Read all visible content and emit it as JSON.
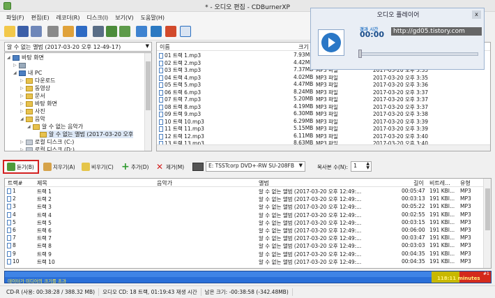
{
  "window": {
    "title": "* - 오디오 편집 - CDBurnerXP"
  },
  "menu": [
    "파일(F)",
    "편집(E)",
    "레코더(R)",
    "디스크(I)",
    "보기(V)",
    "도움말(H)"
  ],
  "toolbar_icons": [
    "new-icon",
    "save-icon",
    "save-as-icon",
    "print-icon",
    "add-icon",
    "remove-icon",
    "burn-icon",
    "copy-disc-icon",
    "erase-icon",
    "settings-icon",
    "network-icon",
    "help-icon",
    "info-icon"
  ],
  "album_select": {
    "value": "알 수 없는 앨범 (2017-03-20 오후 12-49-17)"
  },
  "tree": [
    {
      "label": "바탕 화면",
      "indent": 0
    },
    {
      "label": "",
      "indent": 1
    },
    {
      "label": "내 PC",
      "indent": 1
    },
    {
      "label": "다운로드",
      "indent": 2
    },
    {
      "label": "동영상",
      "indent": 2
    },
    {
      "label": "문서",
      "indent": 2
    },
    {
      "label": "바탕 화면",
      "indent": 2
    },
    {
      "label": "사진",
      "indent": 2
    },
    {
      "label": "음악",
      "indent": 2
    },
    {
      "label": "알 수 없는 음악가",
      "indent": 3
    },
    {
      "label": "알 수 없는 앨범 (2017-03-20 오후",
      "indent": 4
    },
    {
      "label": "로컬 디스크 (C:)",
      "indent": 2
    },
    {
      "label": "로컬 디스크 (D:)",
      "indent": 2
    }
  ],
  "file_list": {
    "headers": {
      "name": "이름",
      "size": "크기"
    },
    "rows": [
      {
        "name": "01 트랙 1.mp3",
        "size": "7.93MB",
        "type": "",
        "date": ""
      },
      {
        "name": "02 트랙 2.mp3",
        "size": "4.42MB",
        "type": "",
        "date": ""
      },
      {
        "name": "03 트랙 3.mp3",
        "size": "7.37MB",
        "type": "MP3 파일",
        "date": "2017-03-20 오후 3:35"
      },
      {
        "name": "04 트랙 4.mp3",
        "size": "4.02MB",
        "type": "MP3 파일",
        "date": "2017-03-20 오후 3:35"
      },
      {
        "name": "05 트랙 5.mp3",
        "size": "4.47MB",
        "type": "MP3 파일",
        "date": "2017-03-20 오후 3:36"
      },
      {
        "name": "06 트랙 6.mp3",
        "size": "8.24MB",
        "type": "MP3 파일",
        "date": "2017-03-20 오후 3:37"
      },
      {
        "name": "07 트랙 7.mp3",
        "size": "5.20MB",
        "type": "MP3 파일",
        "date": "2017-03-20 오후 3:37"
      },
      {
        "name": "08 트랙 8.mp3",
        "size": "4.19MB",
        "type": "MP3 파일",
        "date": "2017-03-20 오후 3:37"
      },
      {
        "name": "09 트랙 9.mp3",
        "size": "6.30MB",
        "type": "MP3 파일",
        "date": "2017-03-20 오후 3:38"
      },
      {
        "name": "10 트랙 10.mp3",
        "size": "6.29MB",
        "type": "MP3 파일",
        "date": "2017-03-20 오후 3:39"
      },
      {
        "name": "11 트랙 11.mp3",
        "size": "5.15MB",
        "type": "MP3 파일",
        "date": "2017-03-20 오후 3:39"
      },
      {
        "name": "12 트랙 12.mp3",
        "size": "6.11MB",
        "type": "MP3 파일",
        "date": "2017-03-20 오후 3:40"
      },
      {
        "name": "13 트랙 13.mp3",
        "size": "8.63MB",
        "type": "MP3 파일",
        "date": "2017-03-20 오후 3:40"
      }
    ]
  },
  "actions": {
    "play": "듣기(B)",
    "erase": "지우기(A)",
    "clear": "비우기(C)",
    "add": "추가(D)",
    "remove": "제거(M)",
    "drive": "E: TSSTcorp DVD+-RW SU-208FB",
    "copies_label": "복사본 수(N):",
    "copies_value": "1"
  },
  "grid": {
    "headers": {
      "track": "트랙#",
      "title": "제목",
      "artist": "음악가",
      "album": "앨범",
      "length": "길이",
      "bitrate": "비트레...",
      "type": "유형"
    },
    "rows": [
      {
        "track": "1",
        "title": "트랙 1",
        "artist": "",
        "album": "알 수 없는 앨범 (2017-03-20 오후 12:49:...",
        "length": "00:05:47",
        "bitrate": "191 KBI...",
        "type": "MP3"
      },
      {
        "track": "2",
        "title": "트랙 2",
        "artist": "",
        "album": "알 수 없는 앨범 (2017-03-20 오후 12:49:...",
        "length": "00:03:13",
        "bitrate": "191 KBI...",
        "type": "MP3"
      },
      {
        "track": "3",
        "title": "트랙 3",
        "artist": "",
        "album": "알 수 없는 앨범 (2017-03-20 오후 12:49:...",
        "length": "00:05:22",
        "bitrate": "191 KBI...",
        "type": "MP3"
      },
      {
        "track": "4",
        "title": "트랙 4",
        "artist": "",
        "album": "알 수 없는 앨범 (2017-03-20 오후 12:49:...",
        "length": "00:02:55",
        "bitrate": "191 KBI...",
        "type": "MP3"
      },
      {
        "track": "5",
        "title": "트랙 5",
        "artist": "",
        "album": "알 수 없는 앨범 (2017-03-20 오후 12:49:...",
        "length": "00:03:15",
        "bitrate": "191 KBI...",
        "type": "MP3"
      },
      {
        "track": "6",
        "title": "트랙 6",
        "artist": "",
        "album": "알 수 없는 앨범 (2017-03-20 오후 12:49:...",
        "length": "00:06:00",
        "bitrate": "191 KBI...",
        "type": "MP3"
      },
      {
        "track": "7",
        "title": "트랙 7",
        "artist": "",
        "album": "알 수 없는 앨범 (2017-03-20 오후 12:49:...",
        "length": "00:03:47",
        "bitrate": "191 KBI...",
        "type": "MP3"
      },
      {
        "track": "8",
        "title": "트랙 8",
        "artist": "",
        "album": "알 수 없는 앨범 (2017-03-20 오후 12:49:...",
        "length": "00:03:03",
        "bitrate": "191 KBI...",
        "type": "MP3"
      },
      {
        "track": "9",
        "title": "트랙 9",
        "artist": "",
        "album": "알 수 없는 앨범 (2017-03-20 오후 12:49:...",
        "length": "00:04:35",
        "bitrate": "191 KBI...",
        "type": "MP3"
      },
      {
        "track": "10",
        "title": "트랙 10",
        "artist": "",
        "album": "알 수 없는 앨범 (2017-03-20 오후 12:49:...",
        "length": "00:04:35",
        "bitrate": "191 KBI...",
        "type": "MP3"
      }
    ]
  },
  "capacity": {
    "label": "데이터가 미디어의 크기를 초과",
    "time": "118:11 minutes",
    "layer": "#1",
    "colors": {
      "fill": "#2a6fd8",
      "yellow": "#c8b800",
      "red": "#d42a1c"
    }
  },
  "status": [
    "CD-R (사용: 00:38:28 / 388.32 MB)",
    "오디오 CD: 18 트랙, 01:19:43 재생 시간",
    "남은 크기: -00:38:58 (-342.48MB)"
  ],
  "player": {
    "title": "오디오 플레이어",
    "close": "x",
    "time_label": "경과 시간",
    "time": "00:00",
    "url": "http://gd05.tistory.com"
  }
}
